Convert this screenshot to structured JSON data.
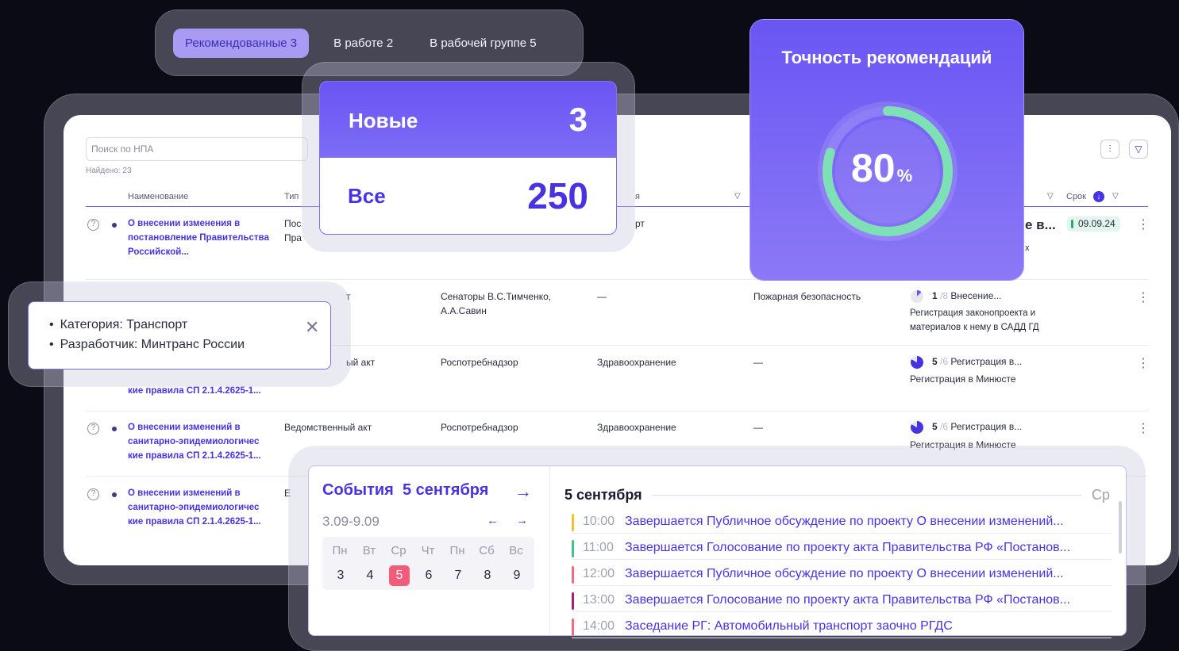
{
  "tabs": [
    {
      "label": "Рекомендованные 3",
      "active": true
    },
    {
      "label": "В работе 2",
      "active": false
    },
    {
      "label": "В рабочей группе 5",
      "active": false
    }
  ],
  "table": {
    "search_placeholder": "Поиск по НПА",
    "found": "Найдено: 23",
    "headers": {
      "name": "Наименование",
      "type": "Тип",
      "col_cut": "я",
      "deadline": "Срок"
    },
    "rows": [
      {
        "name": "О внесении изменения в постановление Правительства Российской...",
        "type": "Пос Пра",
        "author": "",
        "sphere": "рт",
        "stage_name": "е в...",
        "stage_sub": "х",
        "date": "09.09.24"
      },
      {
        "type": "т",
        "author": "Сенаторы В.С.Тимченко, А.А.Савин",
        "sphere": "—",
        "category": "Пожарная безопасность",
        "stage_num": "1",
        "stage_den": "/8",
        "stage_name": "Внесение...",
        "stage_sub": "Регистрация законопроекта и материалов к нему в САДД ГД"
      },
      {
        "name_tail": "кие правила СП 2.1.4.2625-1...",
        "type": "ый акт",
        "author": "Роспотребнадзор",
        "sphere": "Здравоохранение",
        "category": "—",
        "stage_num": "5",
        "stage_den": "/6",
        "stage_name": "Регистрация в...",
        "stage_sub": "Регистрация в Минюсте"
      },
      {
        "name": "О внесении изменений в санитарно-эпидемиологичес кие правила СП 2.1.4.2625-1...",
        "type": "Ведомственный акт",
        "author": "Роспотребнадзор",
        "sphere": "Здравоохранение",
        "category": "—",
        "stage_num": "5",
        "stage_den": "/6",
        "stage_name": "Регистрация в...",
        "stage_sub": "Регистрация в Минюсте"
      },
      {
        "name": "О внесении изменений в санитарно-эпидемиологичес кие правила СП 2.1.4.2625-1...",
        "type": "Е"
      }
    ]
  },
  "counts": {
    "new_label": "Новые",
    "new_value": "3",
    "all_label": "Все",
    "all_value": "250"
  },
  "accuracy": {
    "title": "Точность рекомендаций",
    "value": "80",
    "unit": "%",
    "fraction": 0.8,
    "ring_color": "#7ee0b5"
  },
  "filters": {
    "items": [
      "Категория: Транспорт",
      "Разработчик: Минтранс России"
    ]
  },
  "events": {
    "title": "События",
    "title_date": "5 сентября",
    "range": "3.09-9.09",
    "weekdays": [
      "Пн",
      "Вт",
      "Ср",
      "Чт",
      "Пн",
      "Сб",
      "Вс"
    ],
    "days": [
      "3",
      "4",
      "5",
      "6",
      "7",
      "8",
      "9"
    ],
    "selected_day": "5",
    "day_title": "5 сентября",
    "day_weekday": "Ср",
    "items": [
      {
        "time": "10:00",
        "text": "Завершается Публичное обсуждение по проекту О внесении изменений...",
        "color": "#f3c02f"
      },
      {
        "time": "11:00",
        "text": "Завершается Голосование по проекту акта Правительства РФ «Постанов...",
        "color": "#3fc48a"
      },
      {
        "time": "12:00",
        "text": "Завершается Публичное обсуждение по проекту О внесении изменений...",
        "color": "#f26a85"
      },
      {
        "time": "13:00",
        "text": "Завершается Голосование по проекту акта Правительства РФ «Постанов...",
        "color": "#a0237a"
      },
      {
        "time": "14:00",
        "text": "Заседание РГ: Автомобильный транспорт заочно РГДС",
        "color": "#f26a85"
      }
    ]
  },
  "colors": {
    "accent": "#4733e0",
    "accent_light": "#a99bf4",
    "calendar_selected": "#f15c7a"
  }
}
